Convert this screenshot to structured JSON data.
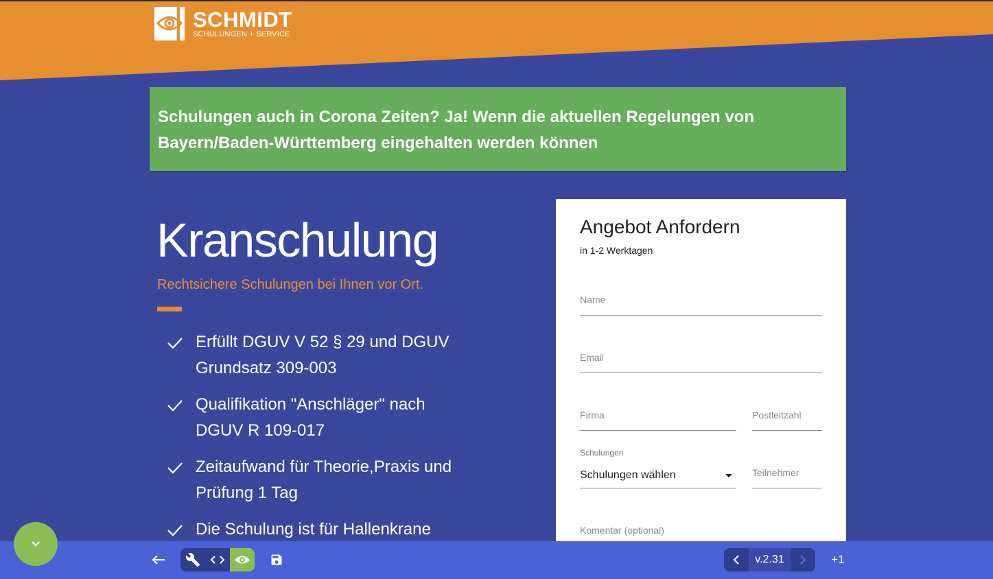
{
  "header": {
    "logo_title": "SCHMIDT",
    "logo_subtitle": "SCHULUNGEN + SERVICE",
    "brand_orange": "#e68f30",
    "brand_blue": "#3b479c"
  },
  "notice": {
    "text": "Schulungen auch in Corona Zeiten? Ja! Wenn die aktuellen Regelungen von Bayern/Baden-Württemberg eingehalten werden können",
    "color": "#66ad5c"
  },
  "hero": {
    "title": "Kranschulung",
    "subtitle": "Rechtsichere Schulungen bei Ihnen vor Ort.",
    "features": [
      "Erfüllt DGUV V 52 § 29 und DGUV Grundsatz 309-003",
      "Qualifikation \"Anschläger\" nach DGUV R 109-017",
      "Zeitaufwand für Theorie,Praxis und Prüfung 1 Tag",
      "Die Schulung ist für Hallenkrane"
    ]
  },
  "form": {
    "title": "Angebot Anfordern",
    "subtitle": "in 1-2 Werktagen",
    "name_placeholder": "Name",
    "email_placeholder": "Email",
    "company_placeholder": "Firma",
    "zip_placeholder": "Postleitzahl",
    "course_label": "Schulungen",
    "course_value": "Schulungen wählen",
    "participants_placeholder": "Teilnehmer",
    "comment_placeholder": "Komentar (optional)"
  },
  "toolbar": {
    "version": "v.2.31",
    "plus_label": "+1",
    "icons": [
      "arrow-left-icon",
      "wrench-icon",
      "code-icon",
      "eye-icon",
      "save-icon",
      "chevron-left-icon",
      "chevron-right-icon",
      "chevron-down-icon"
    ],
    "accent": "#8bbd55"
  }
}
